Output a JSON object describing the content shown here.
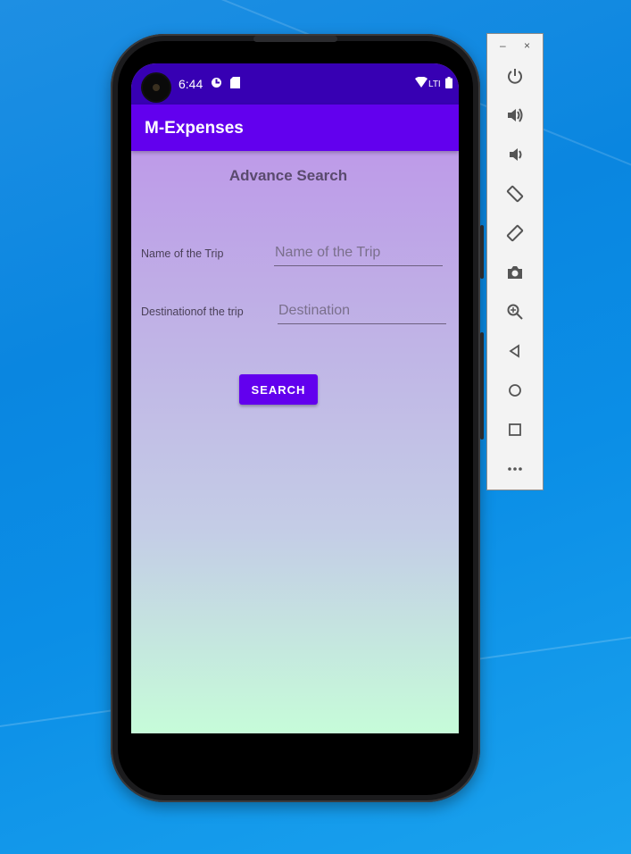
{
  "statusbar": {
    "time": "6:44",
    "signal_text": "LTI"
  },
  "app": {
    "title": "M-Expenses"
  },
  "page": {
    "title": "Advance Search"
  },
  "form": {
    "trip_name_label": "Name of the Trip",
    "trip_name_placeholder": "Name of the Trip",
    "destination_label": "Destinationof the trip",
    "destination_placeholder": "Destination",
    "search_button": "SEARCH"
  },
  "emulator_toolbar": {
    "minimize": "–",
    "close": "×",
    "buttons": [
      "power-icon",
      "volume-up-icon",
      "volume-down-icon",
      "rotate-left-icon",
      "rotate-right-icon",
      "camera-icon",
      "zoom-icon",
      "back-icon",
      "home-icon",
      "overview-icon",
      "more-icon"
    ]
  },
  "colors": {
    "status_bar": "#3700b3",
    "app_bar": "#6200ee",
    "button": "#6200ee"
  }
}
